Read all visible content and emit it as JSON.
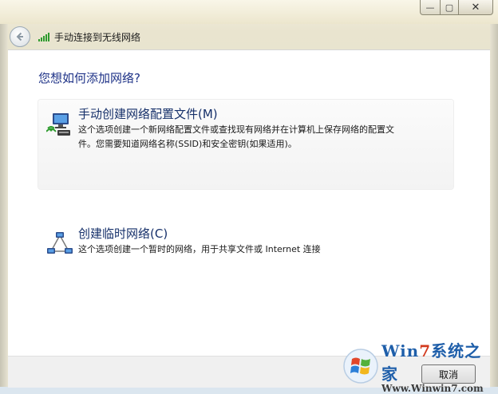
{
  "window": {
    "minimize_glyph": "—",
    "maximize_glyph": "▢",
    "close_glyph": "✕"
  },
  "header": {
    "title": "手动连接到无线网络",
    "back_icon": "back-arrow-icon",
    "network_icon": "wifi-signal-icon"
  },
  "main": {
    "question": "您想如何添加网络?",
    "options": [
      {
        "title": "手动创建网络配置文件(M)",
        "description_line1": "这个选项创建一个新网络配置文件或查找现有网络并在计算机上保存网络的配置文",
        "description_line2": "件。您需要知道网络名称(SSID)和安全密钥(如果适用)。",
        "icon": "manual-network-icon"
      },
      {
        "title": "创建临时网络(C)",
        "description_line1": "这个选项创建一个暂时的网络，用于共享文件或 Internet 连接",
        "icon": "adhoc-network-icon"
      }
    ]
  },
  "footer": {
    "cancel_label": "取消"
  },
  "watermark": {
    "brand_a": "Win",
    "brand_seven": "7",
    "brand_b": "系统之家",
    "url": "Www.Winwin7.com"
  },
  "colors": {
    "accent_heading": "#1e3287",
    "option_title": "#16306a",
    "signal_green": "#2e9b2e"
  }
}
